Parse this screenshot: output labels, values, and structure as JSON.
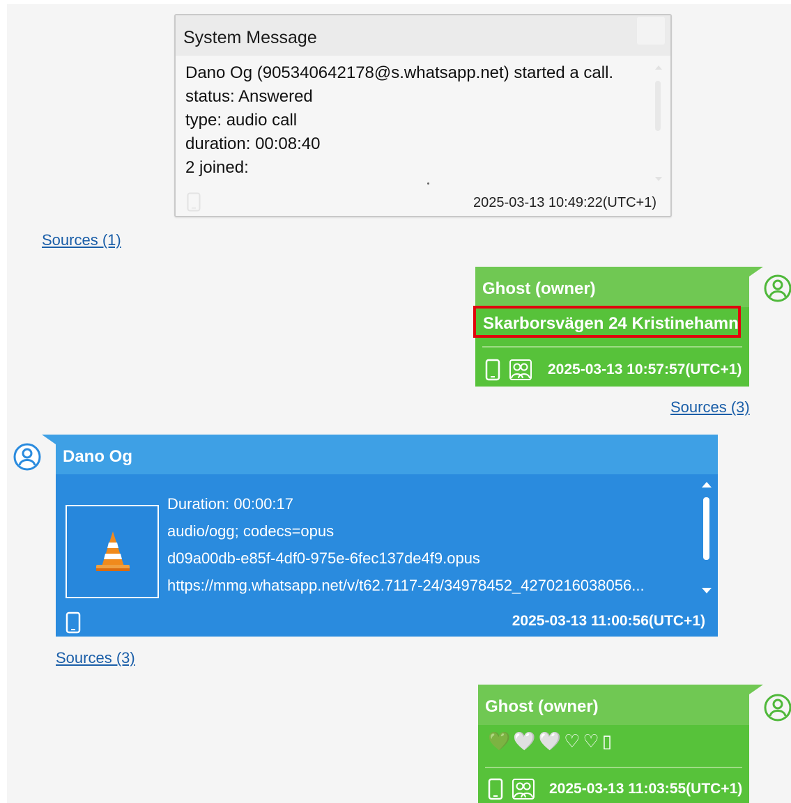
{
  "system_message": {
    "title": "System Message",
    "lines": [
      "Dano Og (905340642178@s.whatsapp.net) started a call.",
      "status: Answered",
      "type: audio call",
      "duration: 00:08:40",
      "2 joined:"
    ],
    "timestamp": "2025-03-13 10:49:22(UTC+1)",
    "sources_label": "Sources (1)"
  },
  "message_1": {
    "sender": "Ghost (owner)",
    "text": "Skarborsvägen 24 Kristinehamn",
    "highlighted": true,
    "timestamp": "2025-03-13 10:57:57(UTC+1)",
    "sources_label": "Sources (3)"
  },
  "message_2": {
    "sender": "Dano Og",
    "attachment_icon": "vlc-cone-icon",
    "lines": [
      "Duration: 00:00:17",
      "audio/ogg; codecs=opus",
      "d09a00db-e85f-4df0-975e-6fec137de4f9.opus",
      "https://mmg.whatsapp.net/v/t62.7117-24/34978452_4270216038056..."
    ],
    "timestamp": "2025-03-13 11:00:56(UTC+1)",
    "sources_label": "Sources (3)"
  },
  "message_3": {
    "sender": "Ghost (owner)",
    "text": "💚🤍🤍♡♡▯",
    "timestamp": "2025-03-13 11:03:55(UTC+1)"
  },
  "colors": {
    "owner_green": "#57c23a",
    "owner_header": "#70c853",
    "contact_blue": "#2a8bde",
    "contact_header": "#3ea0e5",
    "highlight_red": "#e0040d",
    "link_blue": "#1a5ea8"
  }
}
